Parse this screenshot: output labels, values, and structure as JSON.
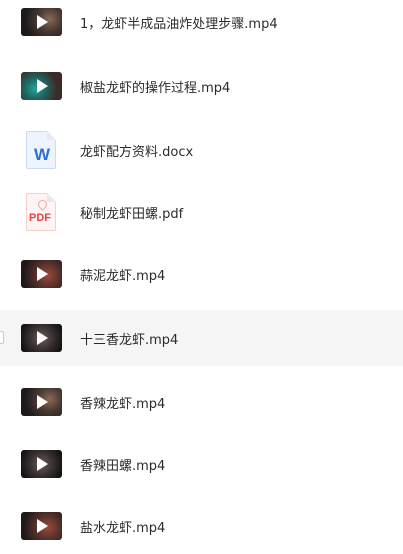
{
  "files": [
    {
      "name": "1，龙虾半成品油炸处理步骤.mp4",
      "icon": "video-thumbnail-icon",
      "type": "video"
    },
    {
      "name": "椒盐龙虾的操作过程.mp4",
      "icon": "video-thumbnail-icon",
      "type": "video"
    },
    {
      "name": "龙虾配方资料.docx",
      "icon": "word-document-icon",
      "type": "docx",
      "badge": "W"
    },
    {
      "name": "秘制龙虾田螺.pdf",
      "icon": "pdf-document-icon",
      "type": "pdf",
      "badge": "PDF"
    },
    {
      "name": "蒜泥龙虾.mp4",
      "icon": "video-thumbnail-icon",
      "type": "video"
    },
    {
      "name": "十三香龙虾.mp4",
      "icon": "video-thumbnail-icon",
      "type": "video",
      "selected": true
    },
    {
      "name": "香辣龙虾.mp4",
      "icon": "video-thumbnail-icon",
      "type": "video"
    },
    {
      "name": "香辣田螺.mp4",
      "icon": "video-thumbnail-icon",
      "type": "video"
    },
    {
      "name": "盐水龙虾.mp4",
      "icon": "video-thumbnail-icon",
      "type": "video"
    }
  ],
  "colors": {
    "selected_row_bg": "#f5f5f5",
    "word_accent": "#2e6fd6",
    "pdf_accent": "#e2463b"
  }
}
